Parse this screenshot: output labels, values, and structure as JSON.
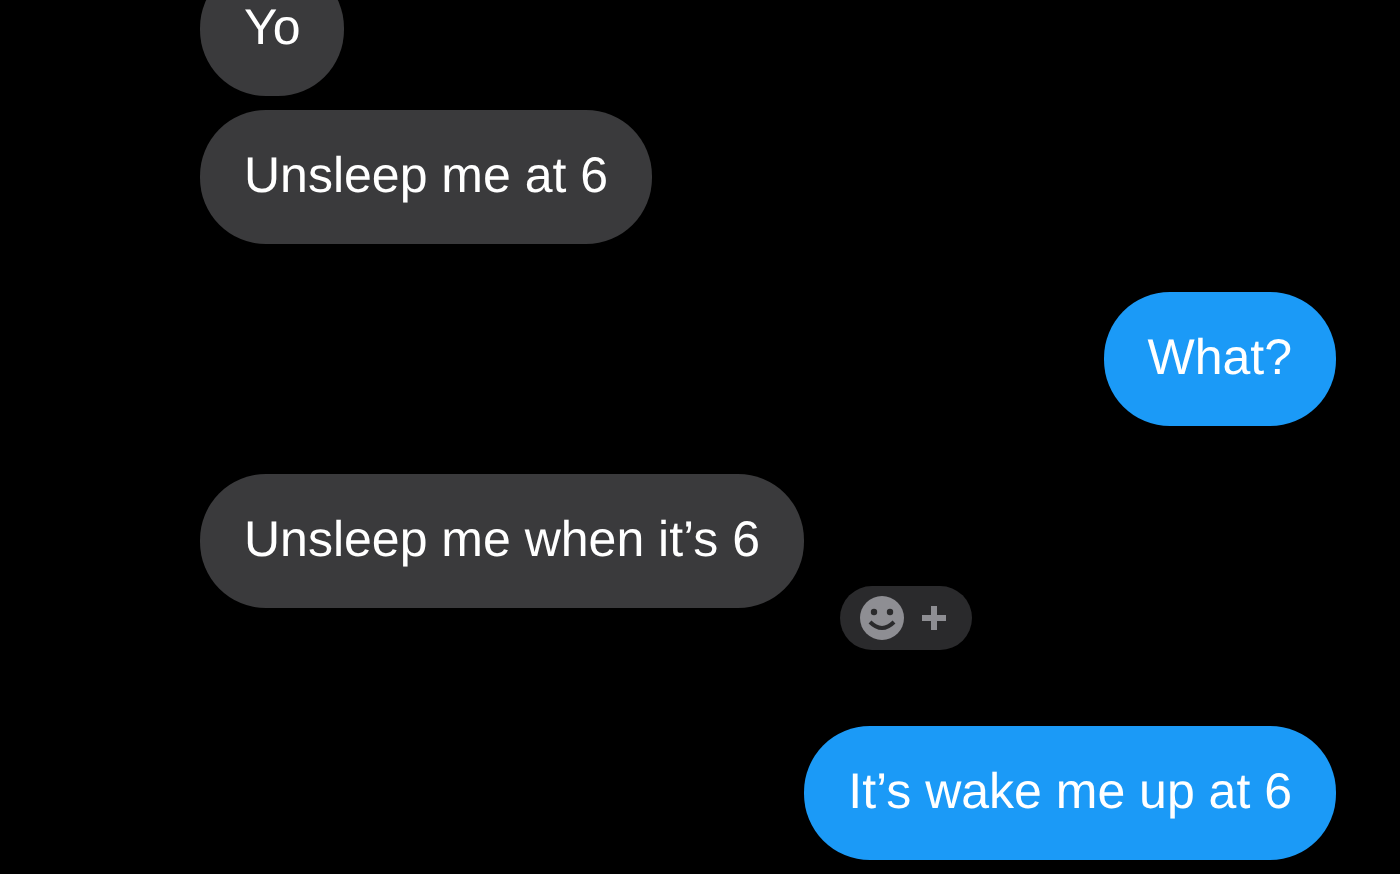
{
  "messages": [
    {
      "kind": "received",
      "text": "Yo",
      "reaction": false
    },
    {
      "kind": "received",
      "text": "Unsleep me at 6",
      "reaction": false
    },
    {
      "kind": "sent",
      "text": "What?",
      "reaction": false
    },
    {
      "kind": "received",
      "text": "Unsleep me when it’s 6",
      "reaction": true
    },
    {
      "kind": "sent",
      "text": "It’s wake me up at 6",
      "reaction": false
    }
  ]
}
